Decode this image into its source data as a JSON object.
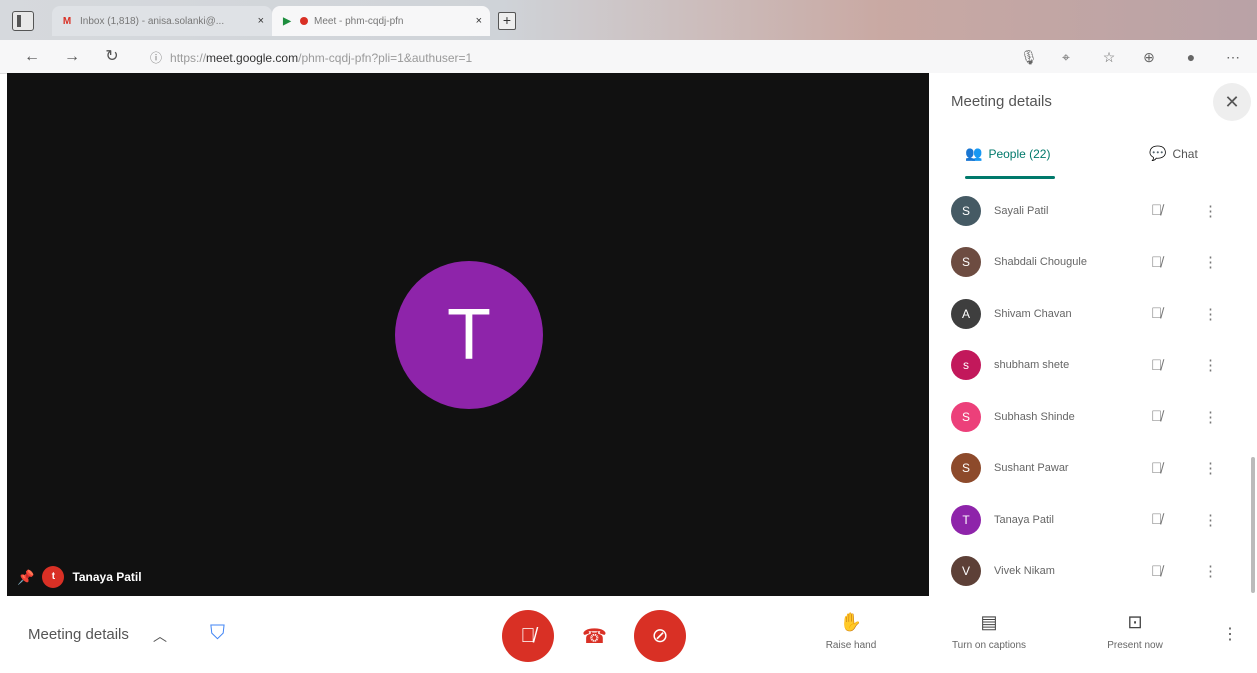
{
  "browser": {
    "tabs": [
      {
        "title": "Inbox (1,818) - anisa.solanki@...",
        "close": "×"
      },
      {
        "title": "Meet - phm-cqdj-pfn",
        "close": "×"
      }
    ],
    "new_tab": "+",
    "url_domain": "meet.google.com",
    "url_prefix": "https://",
    "url_path": "/phm-cqdj-pfn?pli=1&authuser=1"
  },
  "video": {
    "avatar_letter": "T",
    "avatar_color": "#8e24aa",
    "tile_name": "Tanaya Patil",
    "tile_initial": "t"
  },
  "panel": {
    "title": "Meeting details",
    "close": "✕",
    "tabs": {
      "people": "People (22)",
      "chat": "Chat"
    },
    "participants": [
      {
        "name": "Sayali Patil",
        "initial": "S",
        "color": "#455a64"
      },
      {
        "name": "Shabdali Chougule",
        "initial": "S",
        "color": "#6d4c41"
      },
      {
        "name": "Shivam Chavan",
        "initial": "A",
        "color": "#3e3e3e"
      },
      {
        "name": "shubham shete",
        "initial": "s",
        "color": "#c2185b"
      },
      {
        "name": "Subhash Shinde",
        "initial": "S",
        "color": "#ec407a"
      },
      {
        "name": "Sushant Pawar",
        "initial": "S",
        "color": "#8d4a2b"
      },
      {
        "name": "Tanaya Patil",
        "initial": "T",
        "color": "#8e24aa"
      },
      {
        "name": "Vivek Nikam",
        "initial": "V",
        "color": "#5d4037"
      }
    ]
  },
  "bottom": {
    "meeting_details": "Meeting details",
    "actions": [
      {
        "label": "Raise hand",
        "icon": "hand-icon"
      },
      {
        "label": "Turn on captions",
        "icon": "captions-icon"
      },
      {
        "label": "Present now",
        "icon": "present-icon"
      }
    ],
    "accent_red": "#d93025"
  }
}
